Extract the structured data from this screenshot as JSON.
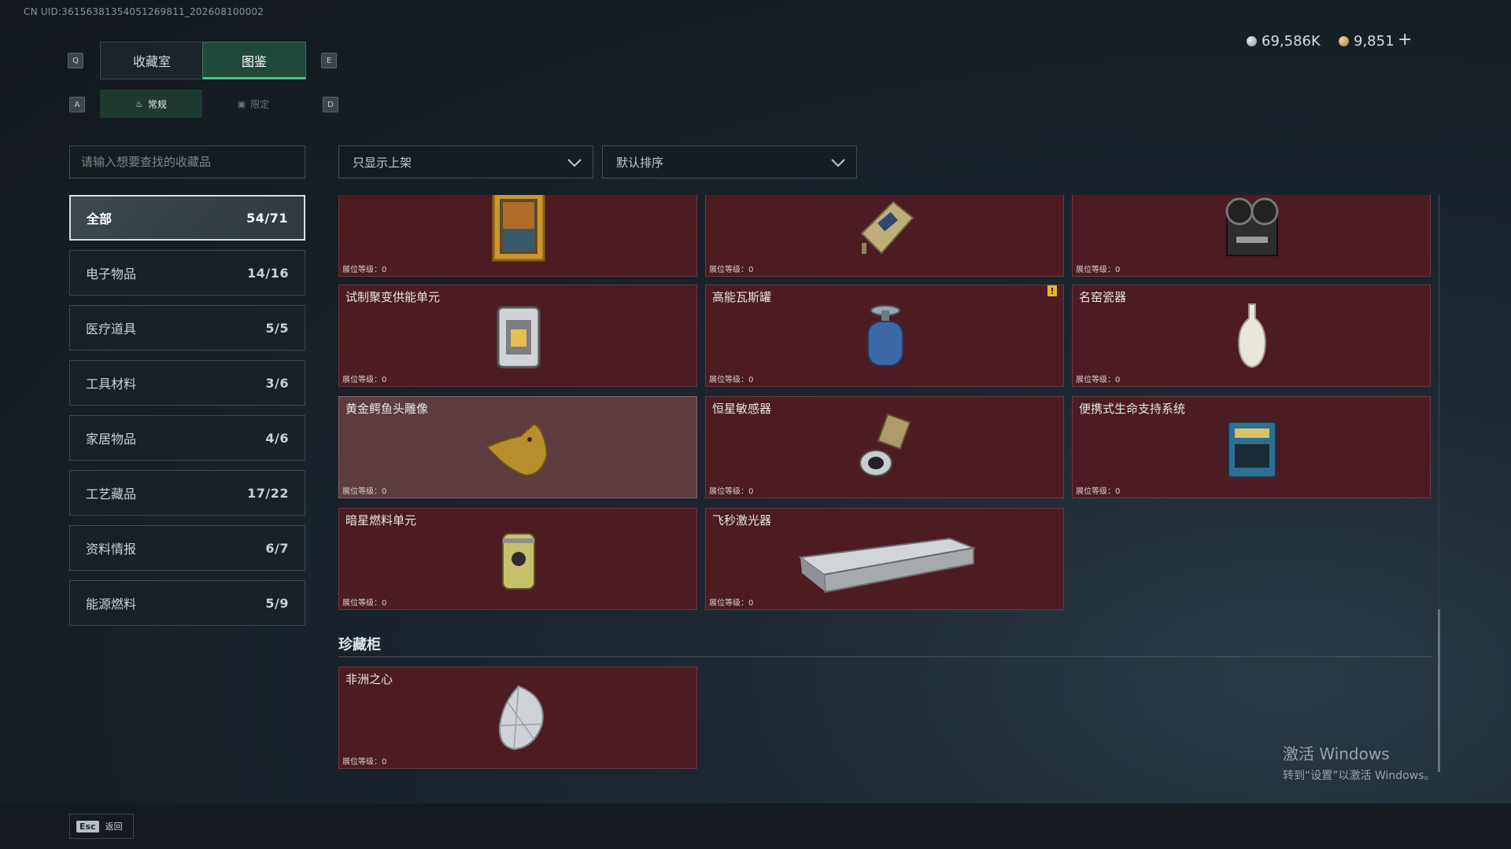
{
  "uid": "CN UID:3615638135405126981​1_202608100002",
  "currency": {
    "primary": "69,586K",
    "secondary": "9,851",
    "add_label": "+"
  },
  "keys": {
    "prev_tab": "Q",
    "next_tab": "E",
    "prev_sub": "A",
    "next_sub": "D"
  },
  "tabs": [
    {
      "label": "收藏室",
      "active": false
    },
    {
      "label": "图鉴",
      "active": true
    }
  ],
  "subtabs": [
    {
      "label": "常规",
      "active": true
    },
    {
      "label": "限定",
      "active": false
    }
  ],
  "search": {
    "placeholder": "请输入想要查找的收藏品"
  },
  "filters": {
    "shelf": "只显示上架",
    "sort": "默认排序"
  },
  "categories": [
    {
      "label": "全部",
      "count": "54/71",
      "active": true
    },
    {
      "label": "电子物品",
      "count": "14/16"
    },
    {
      "label": "医疗道具",
      "count": "5/5"
    },
    {
      "label": "工具材料",
      "count": "3/6"
    },
    {
      "label": "家居物品",
      "count": "4/6"
    },
    {
      "label": "工艺藏品",
      "count": "17/22"
    },
    {
      "label": "资料情报",
      "count": "6/7"
    },
    {
      "label": "能源燃料",
      "count": "5/9"
    }
  ],
  "level_label": "展位等级：0",
  "items": [
    {
      "name": "",
      "icon": "painting-icon"
    },
    {
      "name": "",
      "icon": "device-icon"
    },
    {
      "name": "",
      "icon": "reel-recorder-icon"
    },
    {
      "name": "试制聚变供能单元",
      "icon": "fusion-unit-icon"
    },
    {
      "name": "高能瓦斯罐",
      "icon": "gas-tank-icon",
      "warning": "!"
    },
    {
      "name": "名窑瓷器",
      "icon": "porcelain-vase-icon"
    },
    {
      "name": "黄金鳄鱼头雕像",
      "icon": "gold-croc-icon",
      "highlight": true
    },
    {
      "name": "恒星敏感器",
      "icon": "star-sensor-icon"
    },
    {
      "name": "便携式生命支持系统",
      "icon": "life-support-icon"
    },
    {
      "name": "暗星燃料单元",
      "icon": "fuel-canister-icon"
    },
    {
      "name": "飞秒激光器",
      "icon": "laser-box-icon"
    }
  ],
  "treasure_section": {
    "title": "珍藏柜",
    "items": [
      {
        "name": "非洲之心",
        "icon": "diamond-icon"
      }
    ]
  },
  "esc": {
    "key": "Esc",
    "label": "返回"
  },
  "watermark": {
    "line1": "激活 Windows",
    "line2": "转到“设置”以激活 Windows。"
  }
}
